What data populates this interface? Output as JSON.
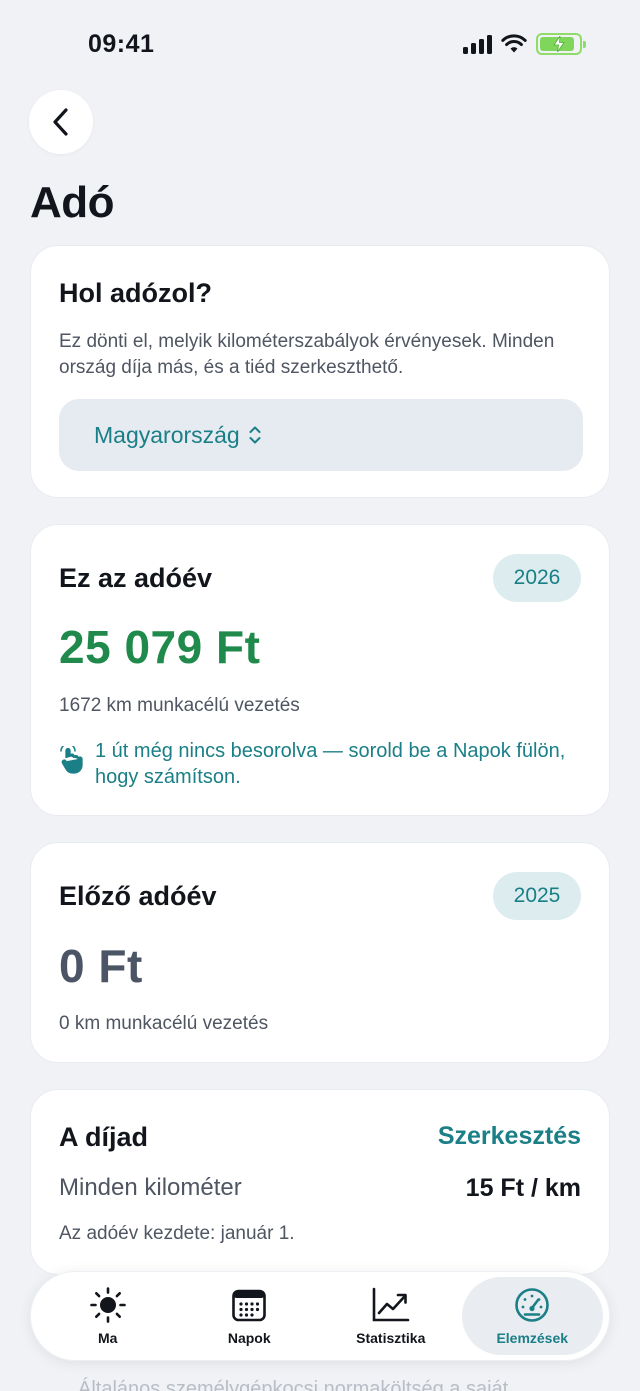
{
  "status": {
    "time": "09:41"
  },
  "page": {
    "title": "Adó"
  },
  "tax_location": {
    "title": "Hol adózol?",
    "description": "Ez dönti el, melyik kilométerszabályok érvényesek. Minden ország díja más, és a tiéd szerkeszthető.",
    "selected_country": "Magyarország"
  },
  "current_year": {
    "title": "Ez az adóév",
    "year": "2026",
    "amount": "25 079 Ft",
    "distance": "1672 km munkacélú vezetés",
    "hint": "1 út még nincs besorolva — sorold be a Napok fülön, hogy számítson."
  },
  "previous_year": {
    "title": "Előző adóév",
    "year": "2025",
    "amount": "0 Ft",
    "distance": "0 km munkacélú vezetés"
  },
  "rate": {
    "title": "A díjad",
    "edit_label": "Szerkesztés",
    "rule_label": "Minden kilométer",
    "rule_value": "15 Ft / km",
    "year_start": "Az adóév kezdete: január 1."
  },
  "faded_text": "Általános személygépkocsi normaköltség a saját",
  "tabs": [
    {
      "label": "Ma",
      "icon": "sun-icon"
    },
    {
      "label": "Napok",
      "icon": "calendar-icon"
    },
    {
      "label": "Statisztika",
      "icon": "chart-line-icon"
    },
    {
      "label": "Elemzések",
      "icon": "gauge-icon"
    }
  ],
  "colors": {
    "accent": "#1a7f86",
    "positive_amount": "#1f8a4c",
    "neutral_amount": "#4b5566",
    "background": "#f0f2f6"
  }
}
